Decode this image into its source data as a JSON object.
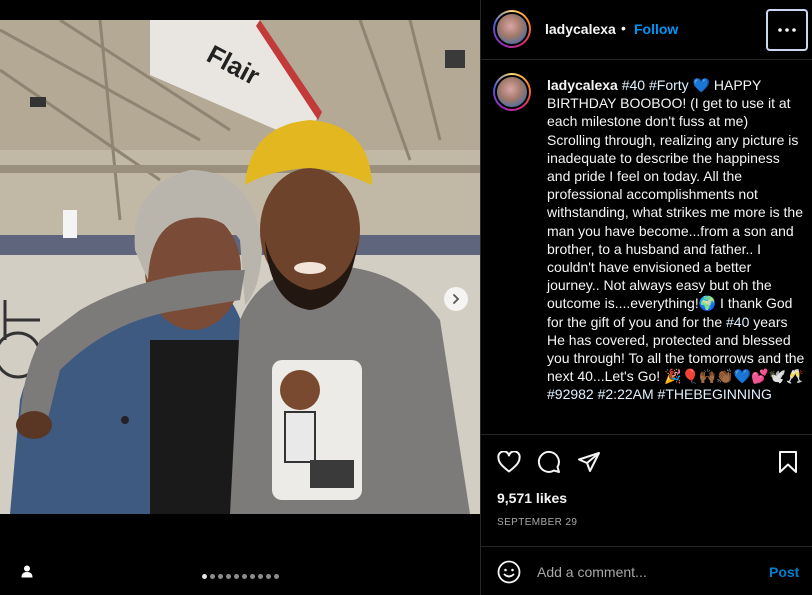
{
  "media": {
    "sign_text": "Flair",
    "carousel_total": 10,
    "carousel_active_index": 0,
    "icons": {
      "next": "chevron-right-icon",
      "tag": "person-tag-icon"
    }
  },
  "post": {
    "author": "ladycalexa",
    "header_separator": "•",
    "follow_label": "Follow",
    "more_icon": "more-horizontal-icon",
    "caption_parts": [
      {
        "text": "#40",
        "hashtag": true
      },
      {
        "text": " ",
        "hashtag": false
      },
      {
        "text": "#Forty",
        "hashtag": true
      },
      {
        "text": " 💙 HAPPY BIRTHDAY BOOBOO! (I get to use it at each milestone don't fuss at me) Scrolling through, realizing any picture is inadequate to describe the happiness and pride I feel on today. All the professional accomplishments not withstanding, what strikes me more is the man you have become...from a son and brother, to a husband and father.. I couldn't have envisioned a better journey.. Not always easy but oh the outcome is....everything!🌍 I thank God for the gift of you and for the ",
        "hashtag": false
      },
      {
        "text": "#40",
        "hashtag": true
      },
      {
        "text": " years He has covered, protected and blessed you through! To all the tomorrows and the next 40...Let's Go! 🎉🎈🙌🏾👏🏾💙💕🕊️🥂 ",
        "hashtag": false
      },
      {
        "text": "#92982",
        "hashtag": true
      },
      {
        "text": " ",
        "hashtag": false
      },
      {
        "text": "#2:22AM",
        "hashtag": true
      },
      {
        "text": " ",
        "hashtag": false
      },
      {
        "text": "#THEBEGINNING",
        "hashtag": true
      }
    ],
    "likes": "9,571 likes",
    "date": "SEPTEMBER 29",
    "action_icons": [
      "heart-icon",
      "comment-icon",
      "share-icon",
      "bookmark-icon"
    ]
  },
  "comment": {
    "placeholder": "Add a comment...",
    "post_label": "Post",
    "emoji_icon": "emoji-smile-icon"
  },
  "colors": {
    "accent": "#0095f6",
    "background": "#000000",
    "text": "#f5f5f5",
    "muted": "#a8a8a8",
    "divider": "#262626"
  }
}
